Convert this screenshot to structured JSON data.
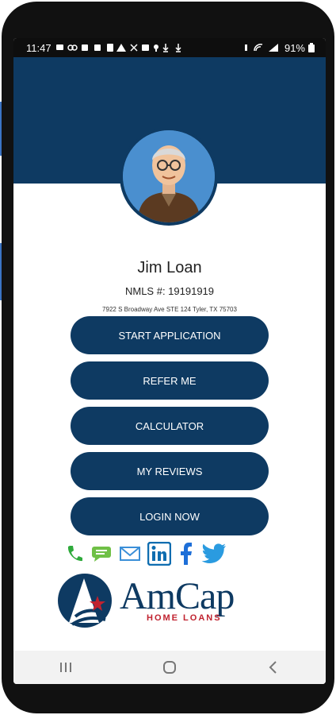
{
  "status_bar": {
    "time": "11:47",
    "battery": "91%"
  },
  "profile": {
    "name": "Jim Loan",
    "nmls": "NMLS #: 19191919",
    "address": "7922 S Broadway Ave STE 124 Tyler, TX 75703"
  },
  "buttons": {
    "start_application": "START APPLICATION",
    "refer_me": "REFER ME",
    "calculator": "CALCULATOR",
    "my_reviews": "MY REVIEWS",
    "login_now": "LOGIN NOW"
  },
  "logo": {
    "brand": "AmCap",
    "tagline": "HOME LOANS"
  },
  "social_icons": [
    "phone-icon",
    "sms-icon",
    "email-icon",
    "linkedin-icon",
    "facebook-icon",
    "twitter-icon"
  ],
  "colors": {
    "primary": "#0e3a62",
    "brand_red": "#c0222f",
    "accent_blue": "#3b74c4"
  }
}
